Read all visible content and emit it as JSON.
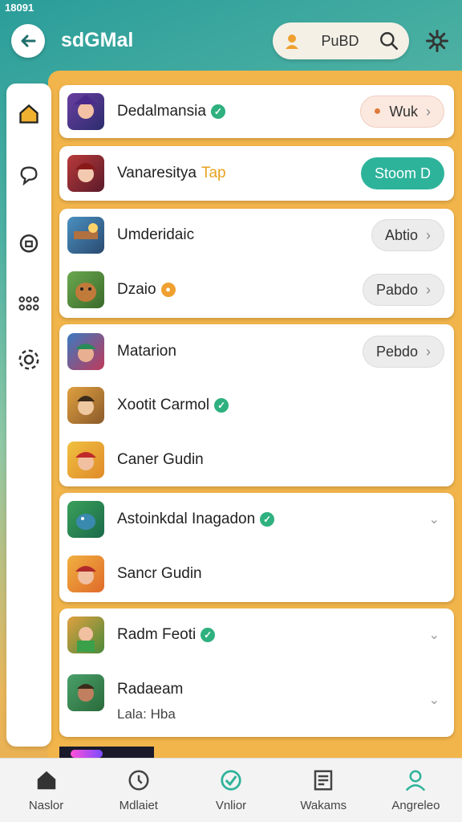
{
  "status": {
    "time": "18091"
  },
  "header": {
    "title": "sdGMal",
    "search_label": "PuBD"
  },
  "colors": {
    "accent_teal": "#2eb39b",
    "verified_green": "#2fb07f",
    "orange": "#f2b54b"
  },
  "sidebar": {
    "items": [
      {
        "icon": "home-icon",
        "active": true
      },
      {
        "icon": "chat-icon"
      },
      {
        "icon": "lock-icon"
      },
      {
        "icon": "grid-icon"
      },
      {
        "icon": "settings-icon"
      }
    ]
  },
  "list": {
    "row1": {
      "name": "Dedalmansia",
      "verified": true,
      "button": "Wuk"
    },
    "row2": {
      "name": "Vanaresitya",
      "tag": "Tap",
      "button": "Stoom D"
    },
    "row3": {
      "name": "Umderidaic",
      "button": "Abtio"
    },
    "row4": {
      "name": "Dzaio",
      "button": "Pabdo"
    },
    "row5": {
      "name": "Matarion",
      "button": "Pebdo"
    },
    "row6": {
      "name": "Xootit Carmol",
      "verified": true
    },
    "row7": {
      "name": "Caner Gudin"
    },
    "row8": {
      "name": "Astoinkdal Inagadon",
      "verified": true
    },
    "row9": {
      "name": "Sancr Gudin"
    },
    "row10": {
      "name": "Radm Feoti",
      "verified": true
    },
    "row11": {
      "name": "Radaeam",
      "subtitle": "Lala: Hba"
    }
  },
  "nav": {
    "items": [
      {
        "label": "Naslor",
        "icon": "home-icon"
      },
      {
        "label": "Mdlaiet",
        "icon": "clock-phone-icon"
      },
      {
        "label": "Vnlior",
        "icon": "check-circle-icon"
      },
      {
        "label": "Wakams",
        "icon": "document-icon"
      },
      {
        "label": "Angreleo",
        "icon": "profile-icon"
      }
    ]
  }
}
